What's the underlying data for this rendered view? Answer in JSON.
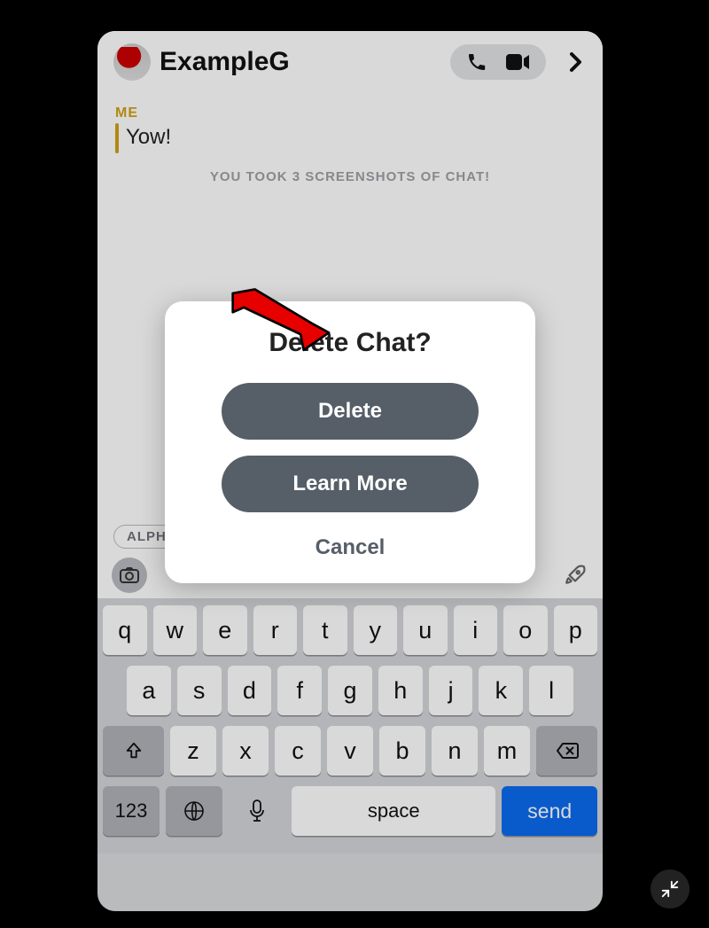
{
  "header": {
    "contact_name": "ExampleG"
  },
  "chat": {
    "me_label": "ME",
    "message": "Yow!",
    "system_notice": "YOU TOOK 3 SCREENSHOTS OF CHAT!",
    "chip_partial": "ALPH"
  },
  "modal": {
    "title": "Delete Chat?",
    "delete_label": "Delete",
    "learn_more_label": "Learn More",
    "cancel_label": "Cancel"
  },
  "keyboard": {
    "row1": [
      "q",
      "w",
      "e",
      "r",
      "t",
      "y",
      "u",
      "i",
      "o",
      "p"
    ],
    "row2": [
      "a",
      "s",
      "d",
      "f",
      "g",
      "h",
      "j",
      "k",
      "l"
    ],
    "row3": [
      "z",
      "x",
      "c",
      "v",
      "b",
      "n",
      "m"
    ],
    "num_key": "123",
    "space_label": "space",
    "send_label": "send"
  }
}
